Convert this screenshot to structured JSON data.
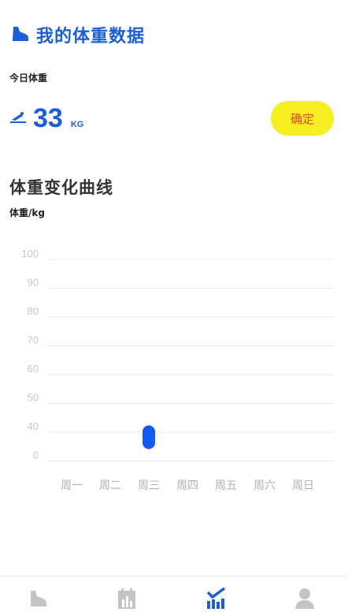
{
  "header": {
    "title": "我的体重数据",
    "icon": "sneaker-icon"
  },
  "today": {
    "label": "今日体重",
    "icon": "scale-icon",
    "value": "33",
    "unit": "KG"
  },
  "confirm_label": "确定",
  "section_title": "体重变化曲线",
  "y_unit_label": "体重/kg",
  "colors": {
    "accent": "#1a5fd6",
    "button_bg": "#f6ee1f",
    "button_text": "#e0442a",
    "point": "#1659f0",
    "grid": "#e9e9e9",
    "tick": "#c8c8c8",
    "tab_inactive": "#c4c4c4"
  },
  "chart_data": {
    "type": "scatter",
    "title": "体重变化曲线",
    "ylabel": "体重/kg",
    "xlabel": "",
    "categories": [
      "周一",
      "周二",
      "周三",
      "周四",
      "周五",
      "周六",
      "周日"
    ],
    "y_ticks": [
      "100",
      "90",
      "80",
      "70",
      "60",
      "50",
      "40",
      "0"
    ],
    "series": [
      {
        "values": [
          null,
          null,
          33,
          null,
          null,
          null,
          null
        ]
      }
    ],
    "grid": true
  },
  "tabs": [
    {
      "icon": "sneaker-icon",
      "active": false
    },
    {
      "icon": "calendar-chart-icon",
      "active": false
    },
    {
      "icon": "chart-check-icon",
      "active": true
    },
    {
      "icon": "person-icon",
      "active": false
    }
  ]
}
